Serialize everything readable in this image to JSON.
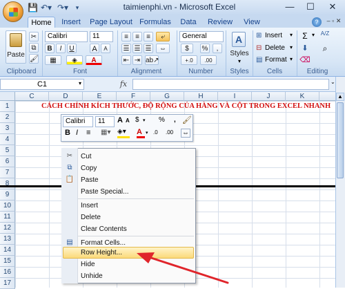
{
  "window": {
    "title": "taimienphi.vn - Microsoft Excel",
    "min_glyph": "—",
    "max_glyph": "☐",
    "close_glyph": "✕"
  },
  "tabs": [
    "Home",
    "Insert",
    "Page Layout",
    "Formulas",
    "Data",
    "Review",
    "View"
  ],
  "ribbon": {
    "clipboard": {
      "label": "Clipboard",
      "paste": "Paste"
    },
    "font": {
      "label": "Font",
      "name": "Calibri",
      "size": "11",
      "bold": "B",
      "italic": "I",
      "underline": "U",
      "grow": "A",
      "shrink": "A",
      "color": "A"
    },
    "alignment": {
      "label": "Alignment"
    },
    "number": {
      "label": "Number",
      "format": "General",
      "currency": "$",
      "percent": "%",
      "comma": ",",
      "inc_dec": "+.0",
      "dec_dec": ".00"
    },
    "styles": {
      "label": "Styles",
      "button": "Styles"
    },
    "cells": {
      "label": "Cells",
      "insert": "Insert",
      "delete": "Delete",
      "format": "Format"
    },
    "editing": {
      "label": "Editing",
      "sum": "Σ",
      "sort": "A/Z",
      "find": "⌕"
    }
  },
  "formula_bar": {
    "name_box": "C1",
    "fx": "fx",
    "content": ""
  },
  "columns": [
    "C",
    "D",
    "E",
    "F",
    "G",
    "H",
    "I",
    "J",
    "K"
  ],
  "rows": [
    "1",
    "2",
    "3",
    "4",
    "5",
    "6",
    "7",
    "8",
    "9",
    "10",
    "11",
    "12",
    "13",
    "14",
    "15",
    "16",
    "17"
  ],
  "sheet": {
    "heading": "CÁCH CHỈNH KÍCH THƯỚC, ĐỘ RỘNG CỦA HÀNG VÀ CỘT TRONG EXCEL NHANH"
  },
  "mini_toolbar": {
    "font": "Calibri",
    "size": "11",
    "grow": "A",
    "shrink": "A",
    "currency": "$",
    "percent": "%",
    "comma": ",",
    "bold": "B",
    "italic": "I",
    "align": "≡",
    "font_color": "A",
    "inc_dec": ".0",
    "dec_dec": ".00"
  },
  "context_menu": {
    "items": [
      "Cut",
      "Copy",
      "Paste",
      "Paste Special...",
      "Insert",
      "Delete",
      "Clear Contents",
      "Format Cells...",
      "Row Height...",
      "Hide",
      "Unhide"
    ],
    "highlighted": "Row Height..."
  },
  "colors": {
    "accent": "#15428b",
    "heading_red": "#d20e0e",
    "arrow_red": "#e0252b",
    "menu_highlight": "#fbd97a"
  }
}
